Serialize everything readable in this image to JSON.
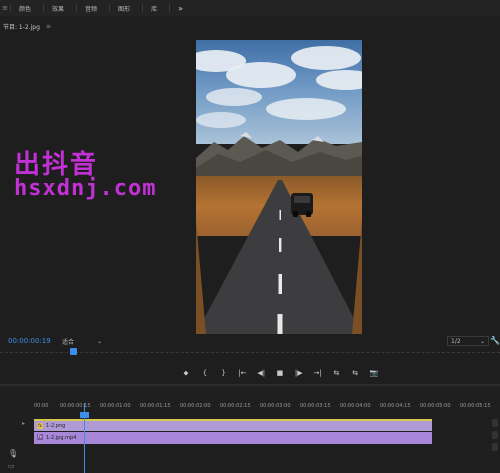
{
  "menubar": {
    "home_icon": "hamburger-icon",
    "items": [
      {
        "label": "颜色"
      },
      {
        "label": "效果"
      },
      {
        "label": "音频"
      },
      {
        "label": "图形"
      },
      {
        "label": "库"
      }
    ],
    "more_label": "»"
  },
  "panel": {
    "title": "节目: 1-2.jpg",
    "menu_label": "≡"
  },
  "watermark": {
    "line1": "出抖音",
    "line2": "hsxdnj.com",
    "color": "#c231d6"
  },
  "monitor": {
    "timecode": "00:00:00:19",
    "fit_label": "适合",
    "resolution": "1/2"
  },
  "transport": {
    "buttons": [
      "⬥",
      "{",
      "}",
      "|←",
      "◀|",
      "■",
      "|▶",
      "→|",
      "⇆",
      "⇆",
      "📷"
    ]
  },
  "timeline": {
    "ruler_labels": [
      "00:00",
      "00:00:00:15",
      "00:00:01:00",
      "00:00:01:15",
      "00:00:02:00",
      "00:00:02:15",
      "00:00:03:00",
      "00:00:03:15",
      "00:00:04:00",
      "00:00:04:15",
      "00:00:05:00",
      "00:00:05:15"
    ],
    "clips": [
      {
        "name": "1-2.png"
      },
      {
        "name": "1-2.jpg.mp4"
      }
    ]
  },
  "colors": {
    "accent": "#3d8ee8",
    "clip_color": "#a887d8"
  }
}
